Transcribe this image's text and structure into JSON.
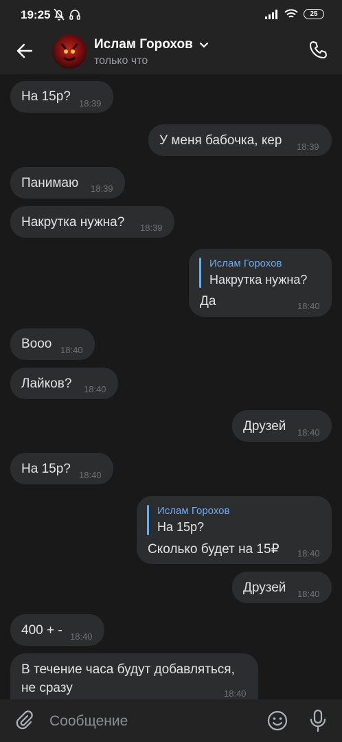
{
  "status_bar": {
    "time": "19:25",
    "battery": "25"
  },
  "header": {
    "name": "Ислам Горохов",
    "status": "только что"
  },
  "messages": [
    {
      "text": "На 15р?",
      "time": "18:39"
    },
    {
      "text": "У меня бабочка, кер",
      "time": "18:39"
    },
    {
      "text": "Панимаю",
      "time": "18:39"
    },
    {
      "text": "Накрутка нужна?",
      "time": "18:39"
    },
    {
      "reply_name": "Ислам Горохов",
      "reply_text": "Накрутка нужна?",
      "text": "Да",
      "time": "18:40"
    },
    {
      "text": "Вооо",
      "time": "18:40"
    },
    {
      "text": "Лайков?",
      "time": "18:40"
    },
    {
      "text": "Друзей",
      "time": "18:40"
    },
    {
      "text": "На 15р?",
      "time": "18:40"
    },
    {
      "reply_name": "Ислам Горохов",
      "reply_text": "На 15р?",
      "text": "Сколько будет на 15₽",
      "time": "18:40"
    },
    {
      "text": "Друзей",
      "time": "18:40"
    },
    {
      "text": "400 + -",
      "time": "18:40"
    },
    {
      "text_line1": "В течение часа будут добавляться,",
      "text_line2": "не сразу",
      "time": "18:40"
    }
  ],
  "composer": {
    "placeholder": "Сообщение"
  },
  "icons": {
    "back": "arrow-left-icon",
    "call": "phone-icon",
    "attach": "paperclip-icon",
    "emoji": "smile-icon",
    "mic": "microphone-icon",
    "chevron": "chevron-down-icon"
  },
  "colors": {
    "background": "#19191a",
    "bubble": "#2c2d2e",
    "accent": "#71aaeb",
    "bar": "#232324"
  }
}
